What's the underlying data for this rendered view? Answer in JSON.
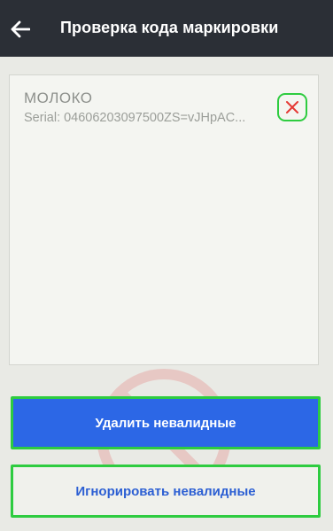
{
  "header": {
    "title": "Проверка кода маркировки",
    "back_icon": "arrow-left-icon"
  },
  "card": {
    "product_name": "МОЛОКО",
    "serial_label": "Serial:",
    "serial_value": "04606203097500ZS=vJHpAC...",
    "remove_icon": "close-x-icon",
    "remove_icon_color": "#e53935"
  },
  "actions": {
    "delete_label": "Удалить невалидные",
    "ignore_label": "Игнорировать невалидные"
  },
  "colors": {
    "header_bg": "#2b2f36",
    "primary_button": "#2c67e6",
    "highlight_border": "#2ecc40"
  }
}
